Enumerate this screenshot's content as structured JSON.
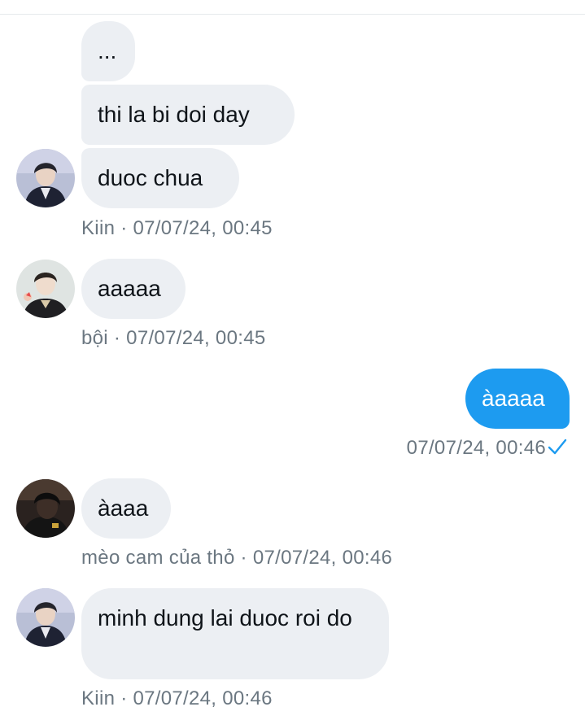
{
  "conversation": {
    "messages": [
      {
        "text": "..."
      },
      {
        "text": "thi la bi doi day"
      },
      {
        "text": "duoc chua"
      },
      {
        "sender": "Kiin",
        "time": "07/07/24, 00:45"
      },
      {
        "text": "aaaaa"
      },
      {
        "sender": "bội",
        "time": "07/07/24, 00:45"
      },
      {
        "text": "àaaaa",
        "outgoing": true
      },
      {
        "time": "07/07/24, 00:46",
        "status_icon": "check-icon"
      },
      {
        "text": "àaaa"
      },
      {
        "sender": "mèo cam của thỏ",
        "time": "07/07/24, 00:46"
      },
      {
        "text": "minh dung lai duoc roi do"
      },
      {
        "sender": "Kiin",
        "time": "07/07/24, 00:46"
      }
    ],
    "separator": " · "
  },
  "colors": {
    "incoming_bubble": "#eceff3",
    "outgoing_bubble": "#1d9bf0",
    "meta_text": "#6b7781",
    "check": "#1d9bf0"
  }
}
